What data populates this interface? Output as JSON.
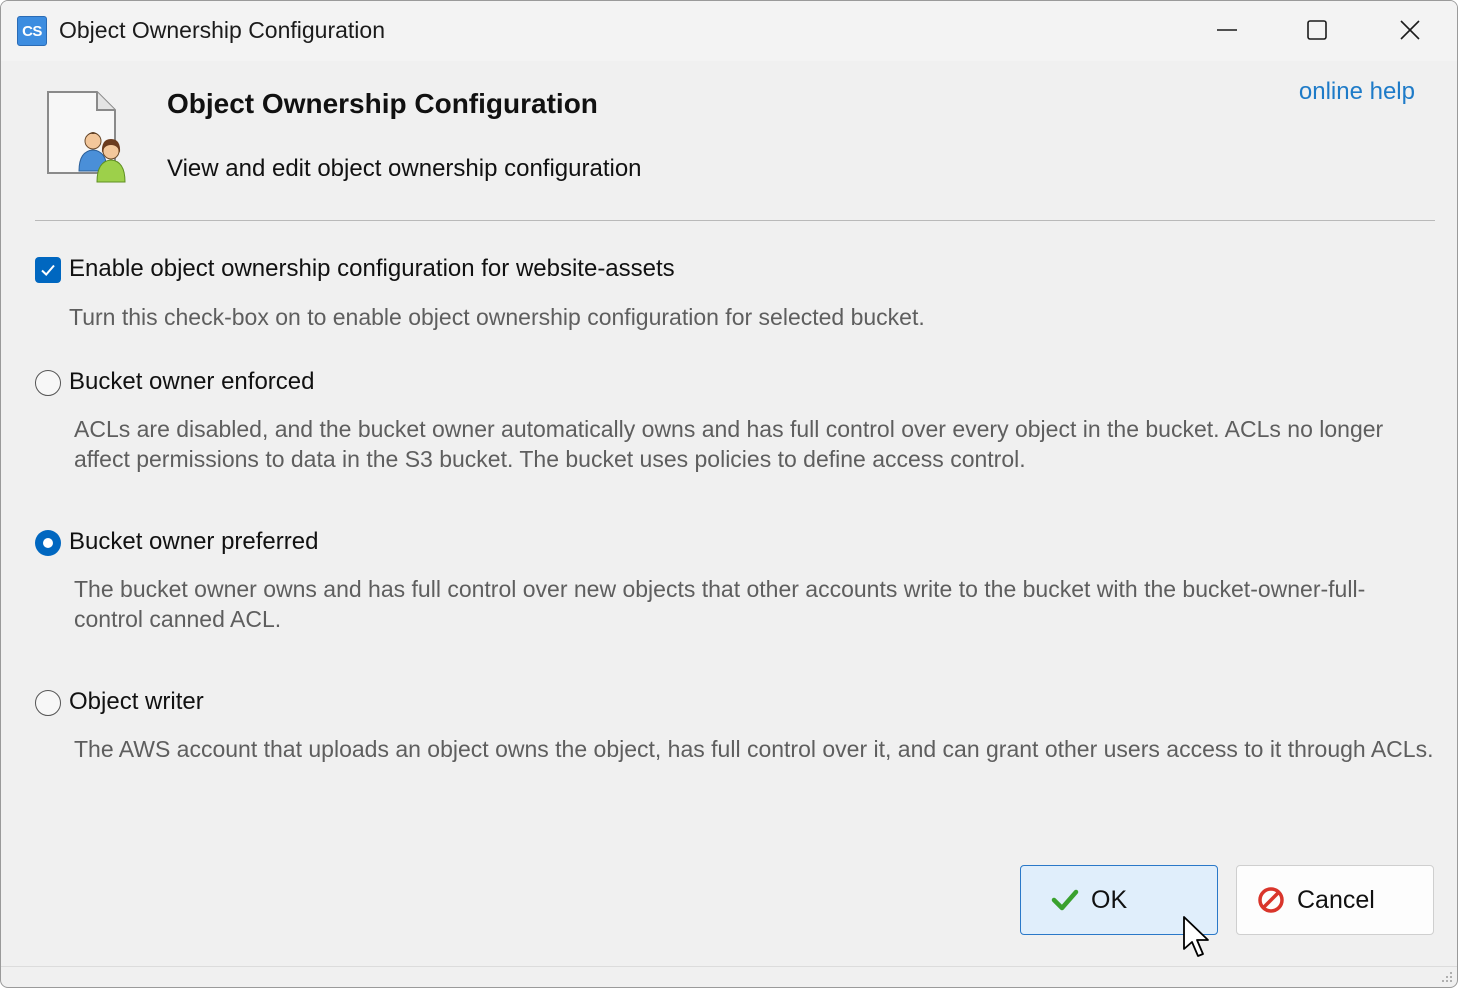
{
  "window": {
    "app_icon_text": "CS",
    "title": "Object Ownership Configuration"
  },
  "header": {
    "title": "Object Ownership Configuration",
    "subtitle": "View and edit object ownership configuration",
    "help_link": "online help"
  },
  "enable": {
    "checked": true,
    "label": "Enable object ownership configuration for website-assets",
    "description": "Turn this check-box on to enable object ownership configuration for selected bucket."
  },
  "options": [
    {
      "label": "Bucket owner enforced",
      "selected": false,
      "description": "ACLs are disabled, and the bucket owner automatically owns and has full control over every object in the bucket. ACLs no longer affect permissions to data in the S3 bucket. The bucket uses policies to define access control."
    },
    {
      "label": "Bucket owner preferred",
      "selected": true,
      "description": "The bucket owner owns and has full control over new objects that other accounts write to the bucket with the bucket-owner-full-control canned ACL."
    },
    {
      "label": "Object writer",
      "selected": false,
      "description": "The AWS account that uploads an object owns the object, has full control over it, and can grant other users access to it through ACLs."
    }
  ],
  "buttons": {
    "ok_label": "OK",
    "cancel_label": "Cancel"
  },
  "colors": {
    "accent": "#0067c0",
    "link": "#1e7bc8",
    "ok_check": "#3aa12e",
    "cancel_icon": "#d9352b"
  },
  "icons": {
    "app": "cs-app-icon",
    "header": "document-users-icon",
    "ok": "checkmark-icon",
    "cancel": "prohibited-icon"
  }
}
